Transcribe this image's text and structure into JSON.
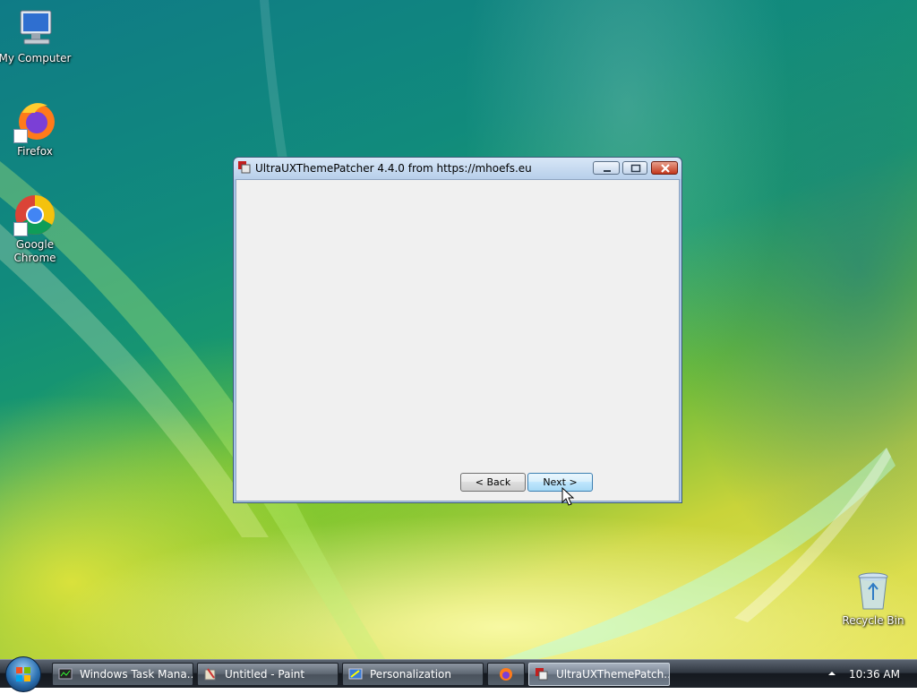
{
  "desktop": {
    "icons": [
      {
        "label": "My Computer",
        "icon": "computer-icon"
      },
      {
        "label": "Firefox",
        "icon": "firefox-icon"
      },
      {
        "label": "Google\nChrome",
        "icon": "chrome-icon"
      },
      {
        "label": "Recycle Bin",
        "icon": "recycle-bin-icon"
      }
    ]
  },
  "window": {
    "title": "UltraUXThemePatcher 4.4.0 from https://mhoefs.eu",
    "back_label": "< Back",
    "next_label": "Next >"
  },
  "taskbar": {
    "tasks": [
      {
        "label": "Windows Task Mana...",
        "icon": "task-manager-icon"
      },
      {
        "label": "Untitled - Paint",
        "icon": "paint-icon"
      },
      {
        "label": "Personalization",
        "icon": "personalization-icon"
      },
      {
        "label": "",
        "icon": "firefox-icon"
      },
      {
        "label": "UltraUXThemePatch...",
        "icon": "patcher-icon",
        "active": true
      }
    ],
    "clock": "10:36 AM"
  },
  "colors": {
    "title_bar": "#b7cfea",
    "client_bg": "#f0f0f0",
    "close_button": "#c4381c",
    "taskbar": "#1e232a"
  }
}
